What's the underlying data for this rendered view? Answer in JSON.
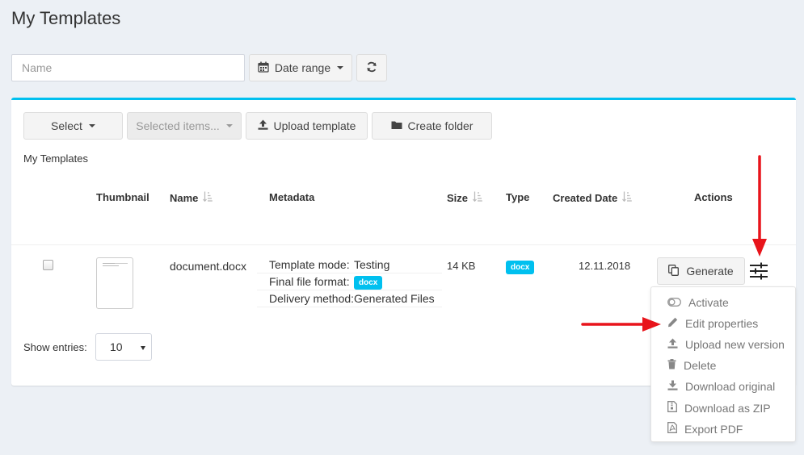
{
  "page": {
    "title": "My Templates"
  },
  "filters": {
    "name_placeholder": "Name",
    "date_range_label": "Date range",
    "refresh_icon": "refresh-icon",
    "calendar_icon": "calendar-icon"
  },
  "toolbar": {
    "select_label": "Select",
    "selected_items_label": "Selected items...",
    "upload_label": "Upload template",
    "create_folder_label": "Create folder"
  },
  "breadcrumb": "My Templates",
  "table": {
    "headers": {
      "thumbnail": "Thumbnail",
      "name": "Name",
      "metadata": "Metadata",
      "size": "Size",
      "type": "Type",
      "created_date": "Created Date",
      "actions": "Actions"
    },
    "rows": [
      {
        "name": "document.docx",
        "metadata": [
          {
            "key": "Template mode:",
            "value": "Testing"
          },
          {
            "key": "Final file format:",
            "value": "docx",
            "badge": true
          },
          {
            "key": "Delivery method:",
            "value": "Generated Files"
          }
        ],
        "size": "14 KB",
        "type": "docx",
        "created": "12.11.2018",
        "generate_label": "Generate"
      }
    ]
  },
  "actions_menu": [
    {
      "label": "Activate",
      "icon": "toggle-icon"
    },
    {
      "label": "Edit properties",
      "icon": "pencil-icon"
    },
    {
      "label": "Upload new version",
      "icon": "upload-icon"
    },
    {
      "label": "Delete",
      "icon": "trash-icon"
    },
    {
      "label": "Download original",
      "icon": "download-icon"
    },
    {
      "label": "Download as ZIP",
      "icon": "zip-file-icon"
    },
    {
      "label": "Export PDF",
      "icon": "pdf-file-icon"
    }
  ],
  "pagination": {
    "show_entries_label": "Show entries:",
    "entries_value": "10"
  },
  "colors": {
    "accent": "#00c0ef",
    "annotation": "#e8141b",
    "background": "#ecf0f5"
  }
}
